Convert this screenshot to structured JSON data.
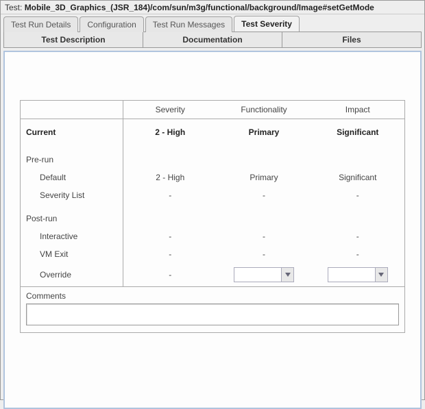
{
  "title": {
    "label": "Test: ",
    "path": "Mobile_3D_Graphics_(JSR_184)/com/sun/m3g/functional/background/Image#setGetMode"
  },
  "tabs": [
    {
      "label": "Test Run Details",
      "active": false
    },
    {
      "label": "Configuration",
      "active": false
    },
    {
      "label": "Test Run Messages",
      "active": false
    },
    {
      "label": "Test Severity",
      "active": true
    }
  ],
  "sub_tabs": [
    {
      "label": "Test Description"
    },
    {
      "label": "Documentation"
    },
    {
      "label": "Files"
    }
  ],
  "table": {
    "headers": [
      "",
      "Severity",
      "Functionality",
      "Impact"
    ],
    "current": {
      "label": "Current",
      "severity": "2 - High",
      "functionality": "Primary",
      "impact": "Significant"
    },
    "prerun": {
      "label": "Pre-run",
      "rows": [
        {
          "label": "Default",
          "severity": "2 - High",
          "functionality": "Primary",
          "impact": "Significant"
        },
        {
          "label": "Severity List",
          "severity": "-",
          "functionality": "-",
          "impact": "-"
        }
      ]
    },
    "postrun": {
      "label": "Post-run",
      "rows": [
        {
          "label": "Interactive",
          "severity": "-",
          "functionality": "-",
          "impact": "-"
        },
        {
          "label": "VM Exit",
          "severity": "-",
          "functionality": "-",
          "impact": "-"
        },
        {
          "label": "Override",
          "severity": "-",
          "functionality_combo": "",
          "impact_combo": ""
        }
      ]
    }
  },
  "comments": {
    "label": "Comments",
    "value": ""
  }
}
